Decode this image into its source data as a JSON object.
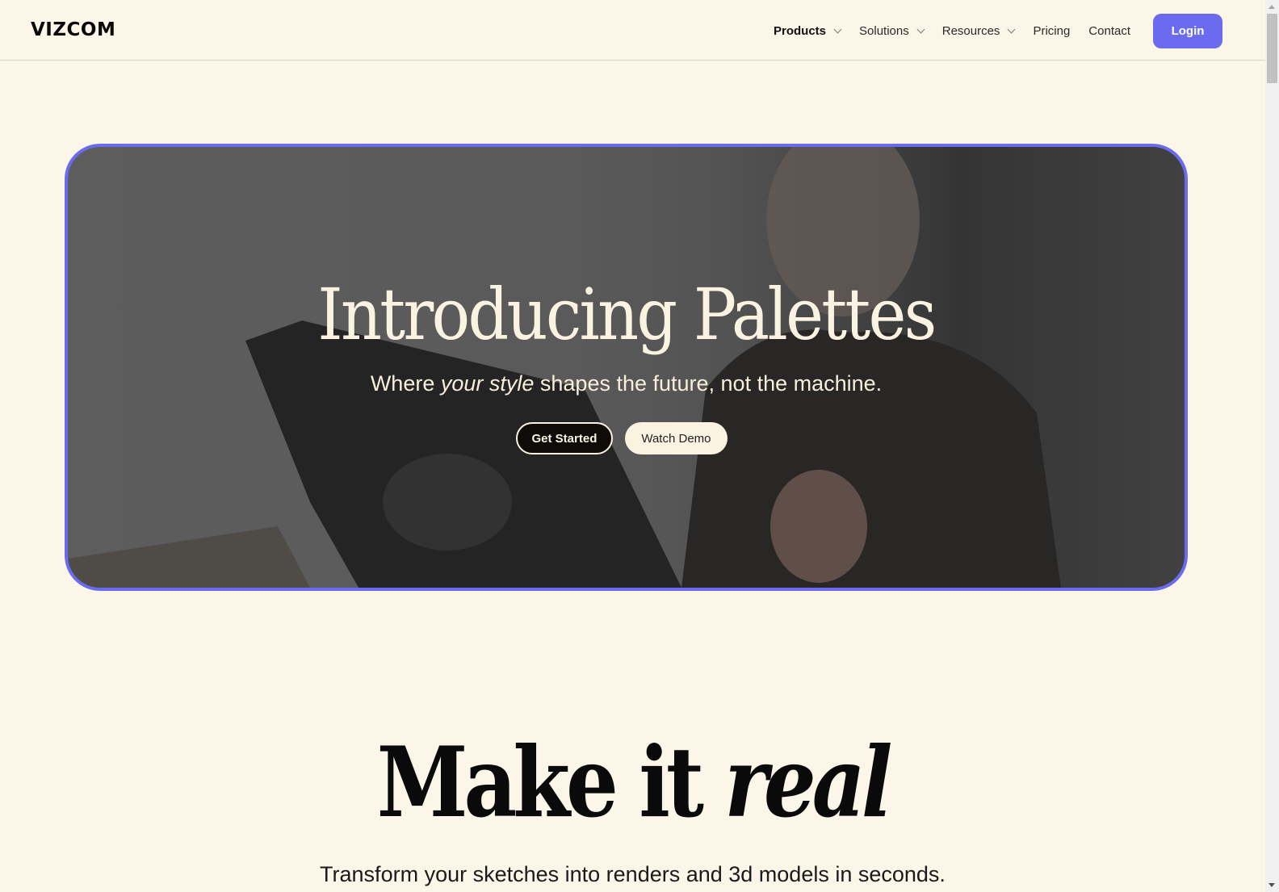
{
  "header": {
    "logo": "VIZCOM",
    "nav": [
      {
        "label": "Products",
        "has_dropdown": true,
        "icon": "chevron-down-icon"
      },
      {
        "label": "Solutions",
        "has_dropdown": true,
        "icon": "chevron-down-icon"
      },
      {
        "label": "Resources",
        "has_dropdown": true,
        "icon": "chevron-down-icon"
      },
      {
        "label": "Pricing",
        "has_dropdown": false
      },
      {
        "label": "Contact",
        "has_dropdown": false
      }
    ],
    "login_label": "Login"
  },
  "hero": {
    "title": "Introducing Palettes",
    "subtitle_before": "Where ",
    "subtitle_em": "your style",
    "subtitle_after": " shapes the future, not the machine.",
    "primary_button": "Get Started",
    "secondary_button": "Watch Demo",
    "background": "video-still-person-with-drawing-tablet"
  },
  "section": {
    "title_plain": "Make it ",
    "title_em": "real",
    "subtitle": "Transform your sketches into renders and 3d models in seconds."
  },
  "colors": {
    "accent": "#6b6bef",
    "background": "#fcf6e8",
    "hero_text": "#fbf3e1",
    "text": "#0a0a0a"
  }
}
